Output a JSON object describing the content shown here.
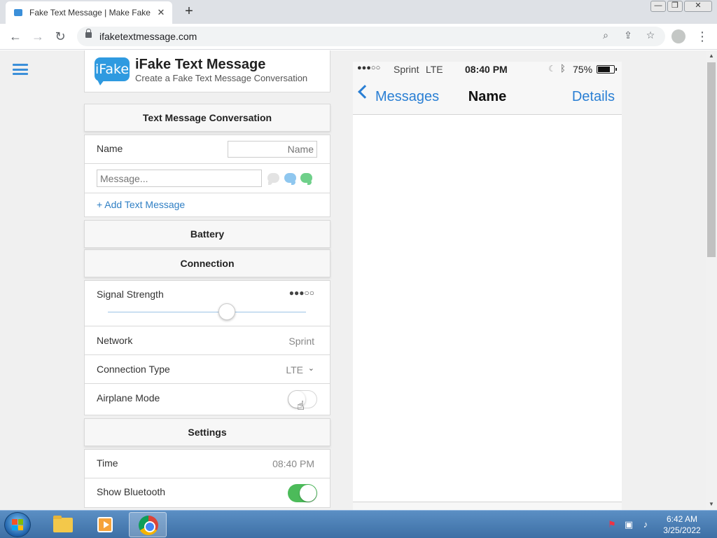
{
  "browser": {
    "tab_title": "Fake Text Message | Make Fake Text Message",
    "tab_close": "✕",
    "new_tab": "+",
    "url": "ifaketextmessage.com",
    "window_controls": {
      "minimize": "—",
      "restore": "❐",
      "close": "✕"
    }
  },
  "site": {
    "logo_text": "iFake",
    "title": "iFake Text Message",
    "subtitle": "Create a Fake Text Message Conversation"
  },
  "conversation": {
    "heading": "Text Message Conversation",
    "name_label": "Name",
    "name_placeholder": "Name",
    "message_placeholder": "Message...",
    "add_link": "+ Add Text Message"
  },
  "battery": {
    "heading": "Battery"
  },
  "connection": {
    "heading": "Connection",
    "signal_label": "Signal Strength",
    "signal_display": "●●●○○",
    "signal_level": 3,
    "signal_max": 5,
    "network_label": "Network",
    "network_value": "Sprint",
    "type_label": "Connection Type",
    "type_value": "LTE",
    "airplane_label": "Airplane Mode",
    "airplane_on": false
  },
  "settings": {
    "heading": "Settings",
    "time_label": "Time",
    "time_value": "08:40 PM",
    "bluetooth_label": "Show Bluetooth",
    "bluetooth_on": true
  },
  "phone": {
    "signal": "●●●○○",
    "carrier": "Sprint",
    "network": "LTE",
    "time": "08:40 PM",
    "battery_pct": "75%",
    "battery_level": 0.75,
    "back_label": "Messages",
    "contact_name": "Name",
    "details_label": "Details"
  },
  "taskbar": {
    "time": "6:42 AM",
    "date": "3/25/2022"
  },
  "colors": {
    "accent": "#2f7fc4",
    "ios_blue": "#2a7fd4",
    "toggle_on": "#4cbb5a"
  }
}
